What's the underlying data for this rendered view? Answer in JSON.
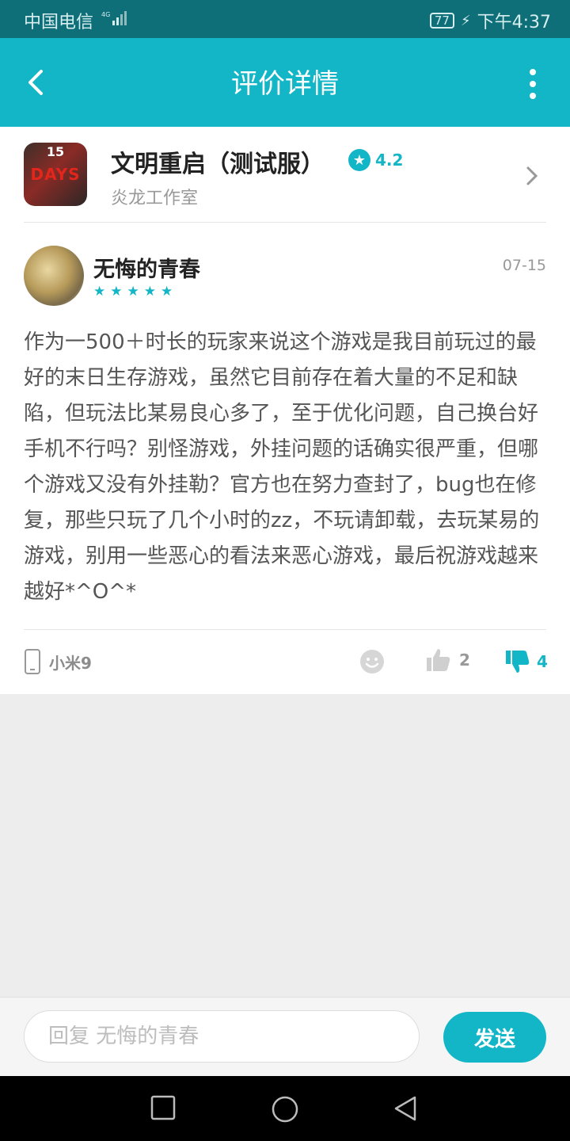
{
  "status_bar": {
    "carrier": "中国电信",
    "network": "4G",
    "battery": "77",
    "time": "下午4:37"
  },
  "toolbar": {
    "title": "评价详情"
  },
  "game": {
    "name": "文明重启（测试服）",
    "rating": "4.2",
    "developer": "炎龙工作室",
    "icon_text_top": "15",
    "icon_text_main": "DAYS"
  },
  "review": {
    "username": "无悔的青春",
    "date": "07-15",
    "stars": 5,
    "stars_text": "★★★★★",
    "text": "作为一500＋时长的玩家来说这个游戏是我目前玩过的最好的末日生存游戏，虽然它目前存在着大量的不足和缺陷，但玩法比某易良心多了，至于优化问题，自己换台好手机不行吗？别怪游戏，外挂问题的话确实很严重，但哪个游戏又没有外挂勒？官方也在努力查封了，bug也在修复，那些只玩了几个小时的zz，不玩请卸载，去玩某易的游戏，别用一些恶心的看法来恶心游戏，最后祝游戏越来越好*^O^*",
    "device": "小米9",
    "likes": "2",
    "dislikes": "4"
  },
  "reply": {
    "placeholder": "回复 无悔的青春",
    "send_label": "发送"
  },
  "colors": {
    "accent": "#13b6c6",
    "status_bar": "#0f6f78"
  }
}
